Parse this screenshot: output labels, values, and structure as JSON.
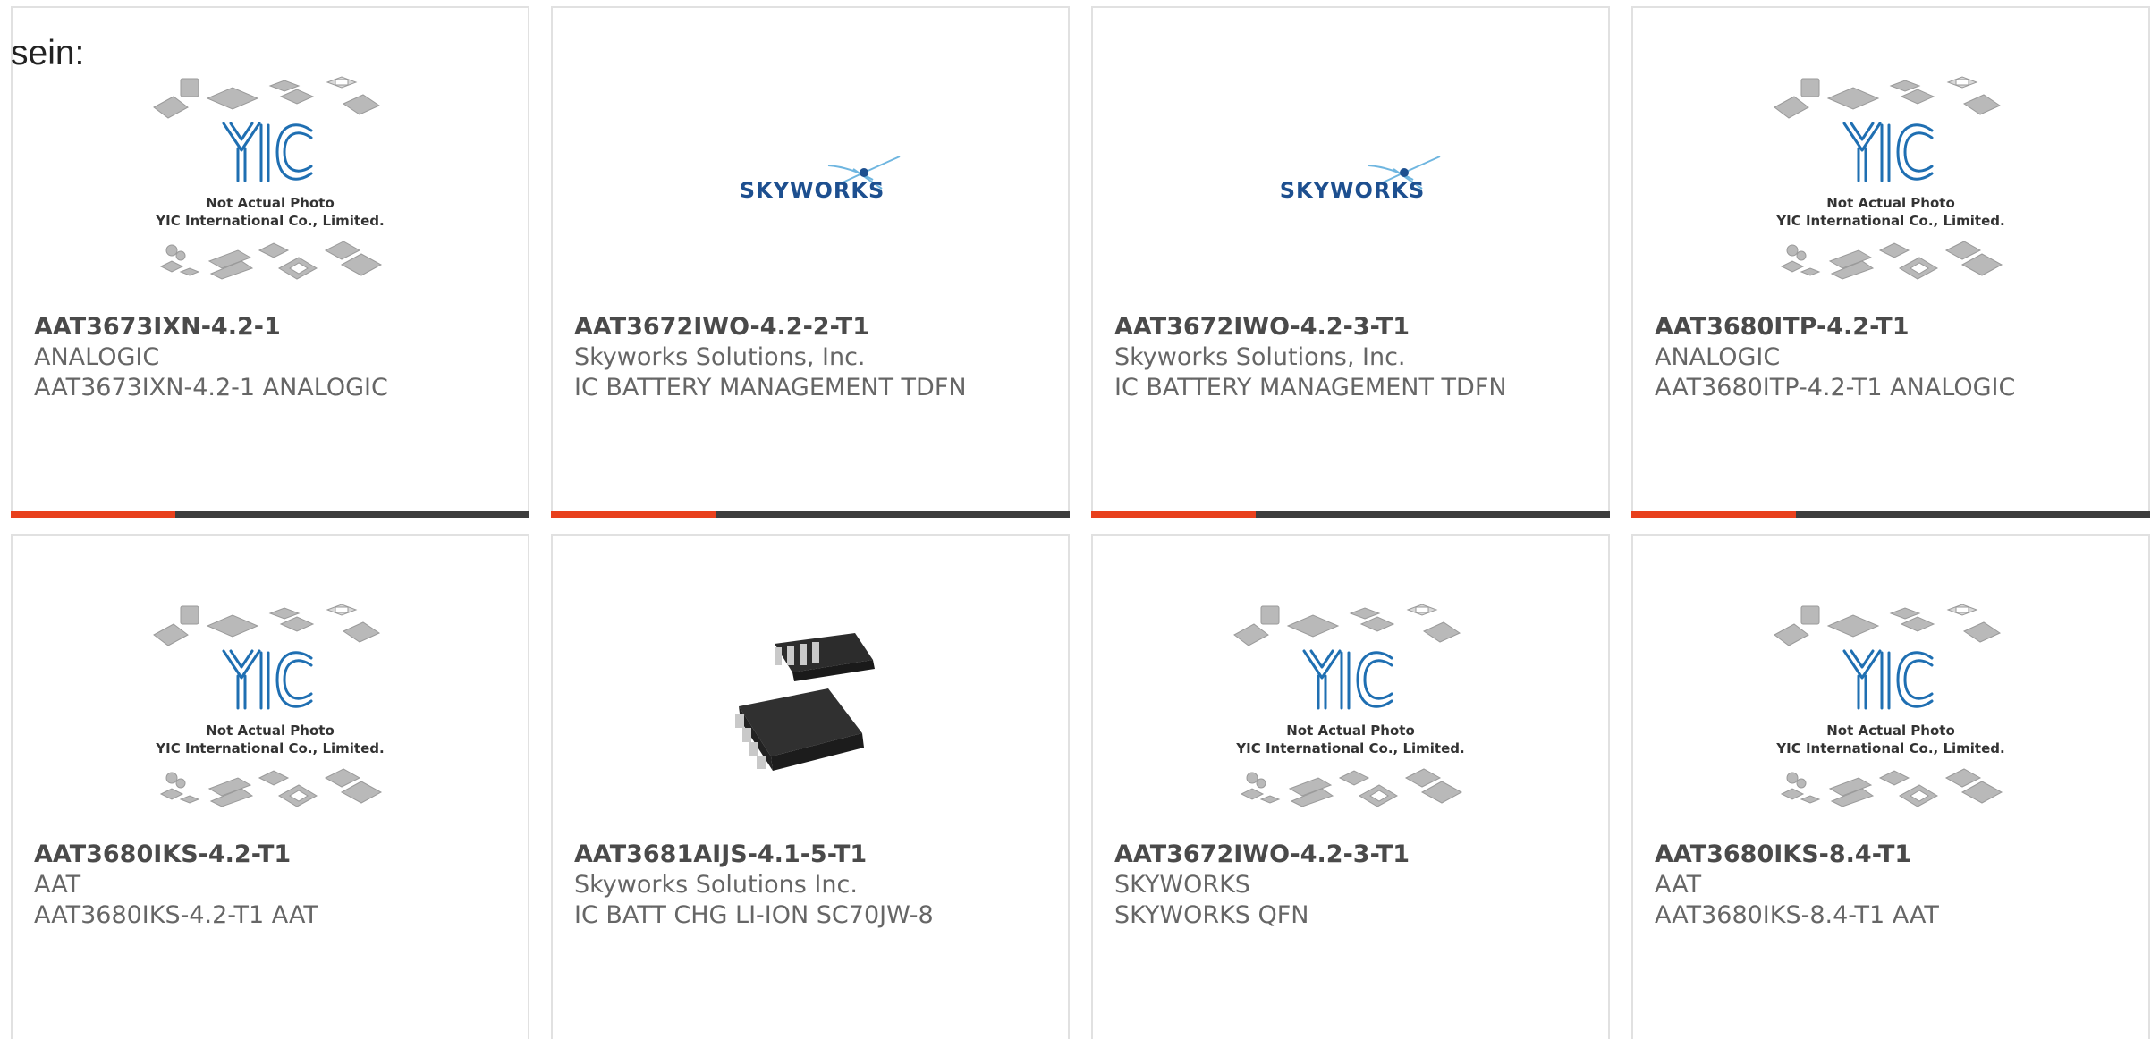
{
  "intro_text": "sein:",
  "placeholder": {
    "line1": "Not Actual Photo",
    "line2": "YIC International Co., Limited."
  },
  "skyworks_logo_text": "SKYWORKS",
  "colors": {
    "accent": "#e8401c",
    "bar": "#3d3d3d",
    "yic_blue": "#1f6fb2",
    "skyworks_blue": "#1d4f8f"
  },
  "products": [
    {
      "part": "AAT3673IXN-4.2-1",
      "manufacturer": "ANALOGIC",
      "description": "AAT3673IXN-4.2-1 ANALOGIC",
      "image": "yic-placeholder"
    },
    {
      "part": "AAT3672IWO-4.2-2-T1",
      "manufacturer": "Skyworks Solutions, Inc.",
      "description": "IC BATTERY MANAGEMENT TDFN",
      "image": "skyworks-logo"
    },
    {
      "part": "AAT3672IWO-4.2-3-T1",
      "manufacturer": "Skyworks Solutions, Inc.",
      "description": "IC BATTERY MANAGEMENT TDFN",
      "image": "skyworks-logo"
    },
    {
      "part": "AAT3680ITP-4.2-T1",
      "manufacturer": "ANALOGIC",
      "description": "AAT3680ITP-4.2-T1 ANALOGIC",
      "image": "yic-placeholder"
    },
    {
      "part": "AAT3680IKS-4.2-T1",
      "manufacturer": "AAT",
      "description": "AAT3680IKS-4.2-T1 AAT",
      "image": "yic-placeholder"
    },
    {
      "part": "AAT3681AIJS-4.1-5-T1",
      "manufacturer": "Skyworks Solutions Inc.",
      "description": "IC BATT CHG LI-ION SC70JW-8",
      "image": "chip-photo"
    },
    {
      "part": "AAT3672IWO-4.2-3-T1",
      "manufacturer": "SKYWORKS",
      "description": "SKYWORKS QFN",
      "image": "yic-placeholder"
    },
    {
      "part": "AAT3680IKS-8.4-T1",
      "manufacturer": "AAT",
      "description": "AAT3680IKS-8.4-T1 AAT",
      "image": "yic-placeholder"
    }
  ]
}
